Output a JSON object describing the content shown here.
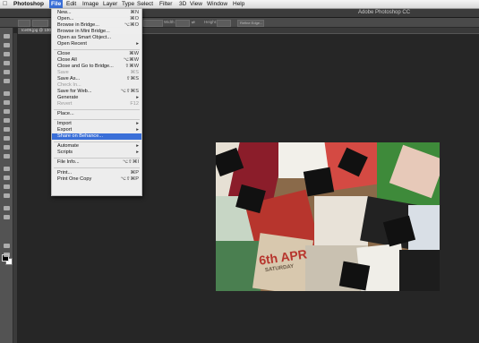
{
  "menubar": {
    "apple": "",
    "app": "Photoshop",
    "items": [
      "File",
      "Edit",
      "Image",
      "Layer",
      "Type",
      "Select",
      "Filter",
      "3D",
      "View",
      "Window",
      "Help"
    ]
  },
  "window": {
    "title": "Adobe Photoshop CC"
  },
  "options_bar": {
    "width_label": "Width:",
    "height_label": "Height:",
    "refine_label": "Refine Edge..."
  },
  "document": {
    "tab": "Ice09.jpg @ 100%"
  },
  "file_menu": {
    "items": [
      {
        "label": "New...",
        "shortcut": "⌘N"
      },
      {
        "label": "Open...",
        "shortcut": "⌘O"
      },
      {
        "label": "Browse in Bridge...",
        "shortcut": "⌥⌘O"
      },
      {
        "label": "Browse in Mini Bridge...",
        "shortcut": ""
      },
      {
        "label": "Open as Smart Object...",
        "shortcut": ""
      },
      {
        "label": "Open Recent",
        "shortcut": "▸"
      },
      {
        "label": "Close",
        "shortcut": "⌘W"
      },
      {
        "label": "Close All",
        "shortcut": "⌥⌘W"
      },
      {
        "label": "Close and Go to Bridge...",
        "shortcut": "⇧⌘W"
      },
      {
        "label": "Save",
        "shortcut": "⌘S"
      },
      {
        "label": "Save As...",
        "shortcut": "⇧⌘S"
      },
      {
        "label": "Check In...",
        "shortcut": ""
      },
      {
        "label": "Save for Web...",
        "shortcut": "⌥⇧⌘S"
      },
      {
        "label": "Generate",
        "shortcut": "▸"
      },
      {
        "label": "Revert",
        "shortcut": "F12"
      },
      {
        "label": "Place...",
        "shortcut": ""
      },
      {
        "label": "Import",
        "shortcut": "▸"
      },
      {
        "label": "Export",
        "shortcut": "▸"
      },
      {
        "label": "Share on Behance...",
        "shortcut": ""
      },
      {
        "label": "Automate",
        "shortcut": "▸"
      },
      {
        "label": "Scripts",
        "shortcut": "▸"
      },
      {
        "label": "File Info...",
        "shortcut": "⌥⇧⌘I"
      },
      {
        "label": "Print...",
        "shortcut": "⌘P"
      },
      {
        "label": "Print One Copy",
        "shortcut": "⌥⇧⌘P"
      }
    ]
  },
  "photo": {
    "text_date": "6th APR",
    "text_day": "SATURDAY"
  },
  "colors": {
    "menu_highlight": "#3a6fd8",
    "workspace": "#262626",
    "toolbar": "#535353"
  }
}
